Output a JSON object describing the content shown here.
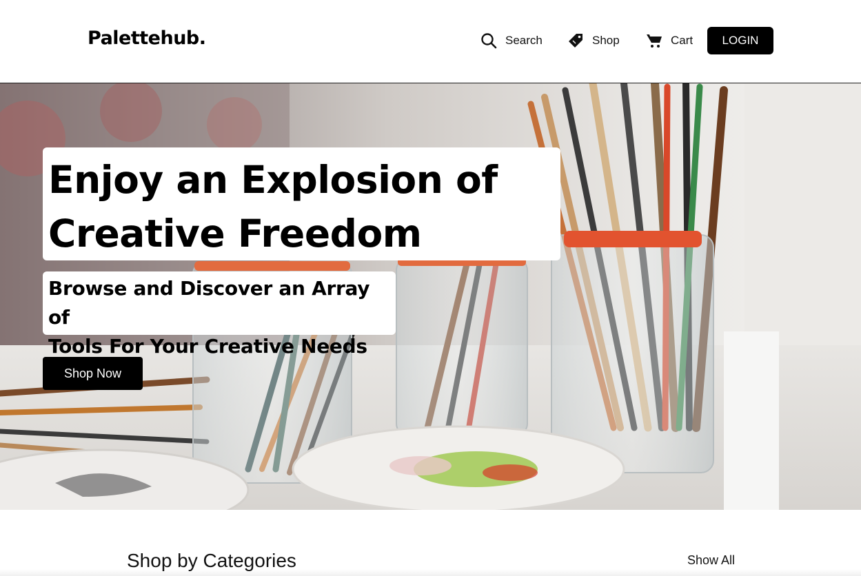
{
  "header": {
    "logo": "Palettehub.",
    "nav": {
      "search_label": "Search",
      "shop_label": "Shop",
      "cart_label": "Cart",
      "login_label": "LOGIN"
    }
  },
  "hero": {
    "headline_line1": "Enjoy an Explosion of",
    "headline_line2": "Creative Freedom",
    "subline_line1": "Browse and Discover an Array of",
    "subline_line2": "Tools For Your Creative Needs",
    "cta_label": "Shop Now"
  },
  "categories": {
    "title": "Shop by Categories",
    "show_all_label": "Show All"
  },
  "icons": {
    "search": "search-icon",
    "shop": "price-tag-icon",
    "cart": "shopping-cart-icon"
  },
  "colors": {
    "button_bg": "#000000",
    "button_text": "#ffffff",
    "page_bg": "#ffffff"
  }
}
